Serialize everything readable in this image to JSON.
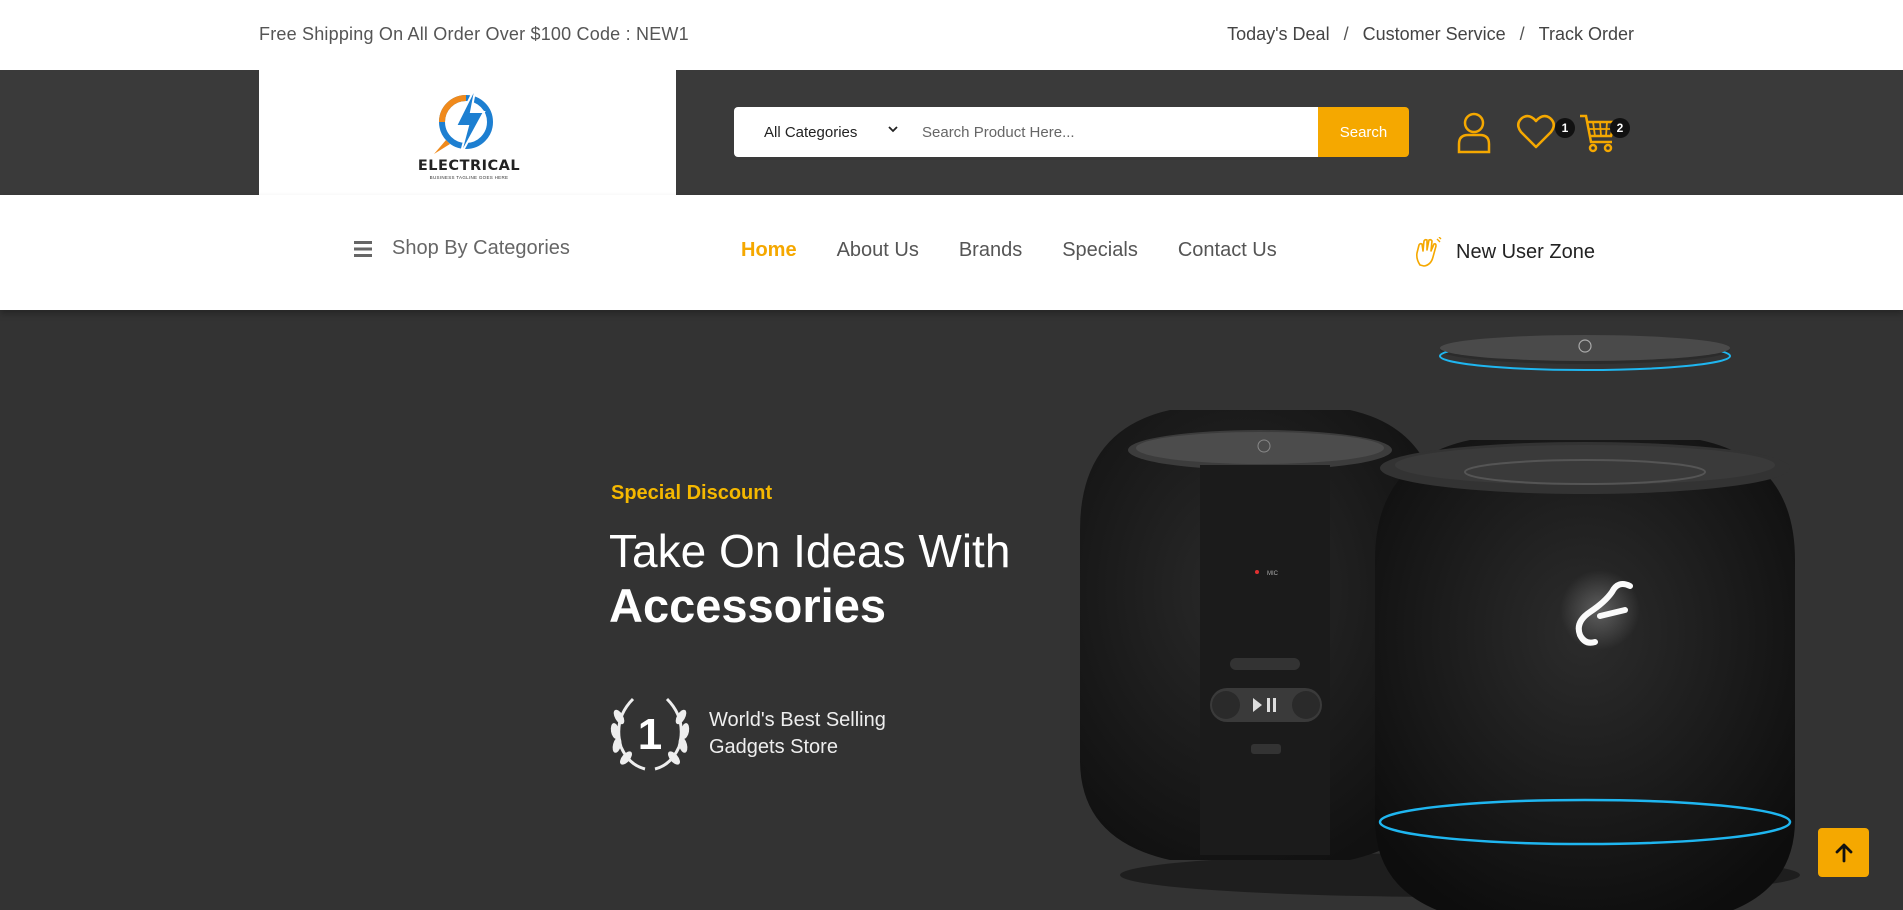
{
  "topbar": {
    "promo": "Free Shipping On All Order Over $100 Code : NEW1",
    "links": [
      "Today's Deal",
      "Customer Service",
      "Track Order"
    ],
    "separator": "/"
  },
  "header": {
    "logo_text": "ELECTRICAL",
    "logo_tagline": "BUSINESS TAGLINE GOES HERE",
    "search": {
      "category": "All Categories",
      "placeholder": "Search Product Here...",
      "button": "Search"
    },
    "wishlist_count": "1",
    "cart_count": "2"
  },
  "nav": {
    "categories_label": "Shop By Categories",
    "menu": [
      "Home",
      "About Us",
      "Brands",
      "Specials",
      "Contact Us"
    ],
    "active": "Home",
    "user_zone": "New User Zone"
  },
  "hero": {
    "eyebrow": "Special Discount",
    "title_line1": "Take On Ideas With",
    "title_line2": "Accessories",
    "award_number": "1",
    "award_line1": "World's Best Selling",
    "award_line2": "Gadgets Store"
  },
  "colors": {
    "accent": "#f5a800",
    "header_bg": "#3a3a3a",
    "hero_bg": "#333333"
  },
  "icons": [
    "chevron-down-icon",
    "user-icon",
    "heart-icon",
    "cart-icon",
    "hamburger-icon",
    "waving-hand-icon",
    "laurel-icon",
    "arrow-up-icon"
  ]
}
